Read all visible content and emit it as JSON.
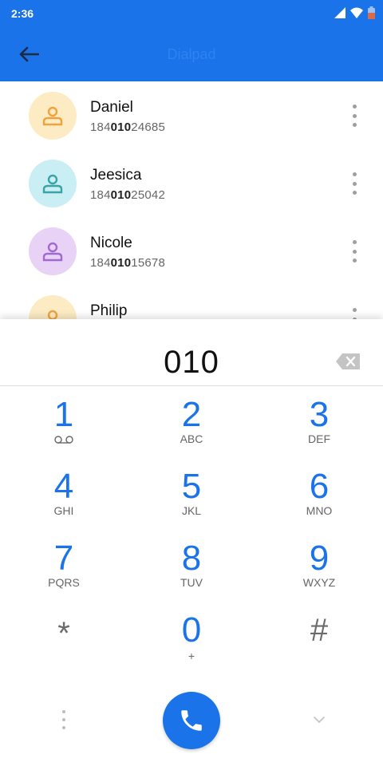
{
  "status_bar": {
    "time": "2:36"
  },
  "app_bar": {
    "title": "Dialpad"
  },
  "contacts": [
    {
      "name": "Daniel",
      "number_prefix": "184",
      "number_match": "010",
      "number_suffix": "24685",
      "avatar_bg": "#fdebc4",
      "avatar_fg": "#f0a33c"
    },
    {
      "name": "Jeesica",
      "number_prefix": "184",
      "number_match": "010",
      "number_suffix": "25042",
      "avatar_bg": "#c9eef3",
      "avatar_fg": "#3aa3a8"
    },
    {
      "name": "Nicole",
      "number_prefix": "184",
      "number_match": "010",
      "number_suffix": "15678",
      "avatar_bg": "#e8d3f7",
      "avatar_fg": "#a06ad1"
    },
    {
      "name": "Philip",
      "number_prefix": "",
      "number_match": "",
      "number_suffix": "",
      "avatar_bg": "#fdebc4",
      "avatar_fg": "#f0a33c"
    }
  ],
  "dialpad": {
    "digits": "010",
    "keys": [
      {
        "digit": "1",
        "letters": ""
      },
      {
        "digit": "2",
        "letters": "ABC"
      },
      {
        "digit": "3",
        "letters": "DEF"
      },
      {
        "digit": "4",
        "letters": "GHI"
      },
      {
        "digit": "5",
        "letters": "JKL"
      },
      {
        "digit": "6",
        "letters": "MNO"
      },
      {
        "digit": "7",
        "letters": "PQRS"
      },
      {
        "digit": "8",
        "letters": "TUV"
      },
      {
        "digit": "9",
        "letters": "WXYZ"
      },
      {
        "digit": "*",
        "letters": ""
      },
      {
        "digit": "0",
        "letters": "+"
      },
      {
        "digit": "#",
        "letters": ""
      }
    ]
  },
  "colors": {
    "accent": "#1a73e8"
  },
  "icons": {
    "back": "arrow-back-icon",
    "voicemail": "voicemail-icon",
    "backspace": "backspace-icon",
    "call": "phone-icon",
    "more": "more-vert-icon",
    "collapse": "chevron-down-icon"
  }
}
